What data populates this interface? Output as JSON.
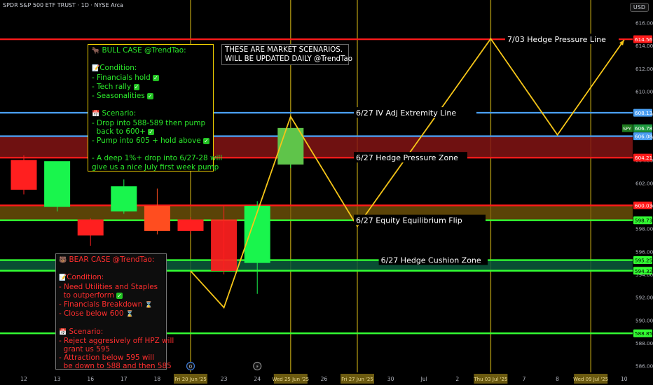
{
  "header": {
    "title": "SPDR S&P 500 ETF TRUST · 1D · NYSE Arca",
    "currency": "USD"
  },
  "chart_data": {
    "type": "candlestick",
    "ylim": [
      585,
      617
    ],
    "y_ticks": [
      586,
      588,
      590,
      592,
      594,
      596,
      598,
      600,
      602,
      604,
      606,
      608,
      610,
      612,
      614,
      616
    ],
    "x_ticks": [
      {
        "label": "12",
        "highlight": false
      },
      {
        "label": "13",
        "highlight": false
      },
      {
        "label": "16",
        "highlight": false
      },
      {
        "label": "17",
        "highlight": false
      },
      {
        "label": "18",
        "highlight": false
      },
      {
        "label": "Fri 20 Jun '25",
        "highlight": true
      },
      {
        "label": "23",
        "highlight": false
      },
      {
        "label": "24",
        "highlight": false
      },
      {
        "label": "Wed 25 Jun '25",
        "highlight": true
      },
      {
        "label": "26",
        "highlight": false
      },
      {
        "label": "Fri 27 Jun '25",
        "highlight": true
      },
      {
        "label": "30",
        "highlight": false
      },
      {
        "label": "Jul",
        "highlight": false
      },
      {
        "label": "2",
        "highlight": false
      },
      {
        "label": "Thu 03 Jul '25",
        "highlight": true
      },
      {
        "label": "7",
        "highlight": false
      },
      {
        "label": "8",
        "highlight": false
      },
      {
        "label": "Wed 09 Jul '25",
        "highlight": true
      },
      {
        "label": "10",
        "highlight": false
      }
    ],
    "candles": [
      {
        "slot": 0,
        "open": 604.0,
        "high": 604.4,
        "close": 601.4,
        "low": 601.0,
        "color": "red"
      },
      {
        "slot": 1,
        "open": 599.9,
        "high": 601.0,
        "close": 603.9,
        "low": 599.5,
        "color": "green"
      },
      {
        "slot": 2,
        "open": 598.8,
        "high": 598.9,
        "close": 597.4,
        "low": 596.5,
        "color": "red"
      },
      {
        "slot": 3,
        "open": 599.5,
        "high": 602.3,
        "close": 601.7,
        "low": 599.3,
        "color": "green"
      },
      {
        "slot": 4,
        "open": 600.0,
        "high": 601.5,
        "close": 597.8,
        "low": 597.5,
        "color": "orange"
      },
      {
        "slot": 5,
        "open": 598.8,
        "high": 599.0,
        "close": 597.8,
        "low": 597.5,
        "color": "red"
      },
      {
        "slot": 6,
        "open": 598.8,
        "high": 600.0,
        "close": 594.3,
        "low": 594.0,
        "color": "red"
      },
      {
        "slot": 7,
        "open": 595.0,
        "high": 600.4,
        "close": 600.0,
        "low": 592.3,
        "color": "green"
      },
      {
        "slot": 8,
        "open": 603.6,
        "high": 606.0,
        "close": 606.8,
        "low": 603.3,
        "color": "green"
      }
    ],
    "scenario_path": [
      {
        "slot": 5,
        "value": 594.3
      },
      {
        "slot": 6,
        "value": 591.1
      },
      {
        "slot": 8,
        "value": 607.8
      },
      {
        "slot": 10,
        "value": 598.2
      },
      {
        "slot": 14,
        "value": 614.6
      },
      {
        "slot": 16,
        "value": 606.2
      },
      {
        "slot": 18,
        "value": 614.5
      }
    ],
    "levels": [
      {
        "label": "7/03 Hedge Pressure Line",
        "value": 614.56,
        "price_label": "614.56",
        "color": "#ff1a1a",
        "label_slot": 15.0
      },
      {
        "label": "6/27 IV Adj Extremity Line",
        "value": 608.13,
        "price_label": "608.13",
        "color": "#4a9ef0",
        "label_slot": 10.0
      },
      {
        "label": "",
        "value": 606.08,
        "price_label": "606.08",
        "color": "#4a9ef0",
        "label_slot": null
      },
      {
        "label": "6/27 Hedge Pressure Zone",
        "value": 604.21,
        "price_label": "604.21",
        "color": "#ff1a1a",
        "label_slot": 10.0
      },
      {
        "label": "",
        "value": 600.03,
        "price_label": "600.03",
        "color": "#ff1a1a",
        "label_slot": null
      },
      {
        "label": "6/27 Equity Equilibrium Flip",
        "value": 598.73,
        "price_label": "598.73",
        "color": "#33ff33",
        "label_slot": 10.0
      },
      {
        "label": "6/27 Hedge Cushion Zone",
        "value": 595.25,
        "price_label": "595.25",
        "color": "#33ff33",
        "label_slot": 11.0
      },
      {
        "label": "",
        "value": 594.32,
        "price_label": "594.32",
        "color": "#33ff33",
        "label_slot": null
      },
      {
        "label": "",
        "value": 588.85,
        "price_label": "588.85",
        "color": "#33ff33",
        "label_slot": null
      }
    ],
    "zones": [
      {
        "from": 604.21,
        "to": 606.08,
        "color": "rgba(130,20,20,0.85)"
      },
      {
        "from": 598.73,
        "to": 600.03,
        "color": "rgba(120,90,10,0.75)"
      },
      {
        "from": 594.32,
        "to": 595.25,
        "color": "rgba(10,90,60,0.85)"
      }
    ],
    "current_price": {
      "symbol": "SPY",
      "value": 606.78,
      "label": "606.78"
    },
    "vertical_markers": [
      5,
      8,
      10,
      14,
      17
    ],
    "bottom_markers": [
      {
        "slot": 5,
        "glyph": "0"
      },
      {
        "slot": 7,
        "glyph": "⚡"
      }
    ]
  },
  "annotations": {
    "bull": {
      "title": "BULL CASE @TrendTao:",
      "condition_heading": "Condition:",
      "conditions": [
        "- Financials hold",
        "- Tech rally",
        "- Seasonalities"
      ],
      "scenario_heading": "Scenario:",
      "scenario_lines": [
        "- Drop into 588-589 then pump",
        "  back to 600+",
        "- Pump into 605 + hold above"
      ],
      "note_lines": [
        "- A deep 1%+ drop into 6/27-28 will",
        "give us a nice July first week pump"
      ]
    },
    "bear": {
      "title": "BEAR CASE @TrendTao:",
      "condition_heading": "Condition:",
      "conditions": [
        "- Need Utilities and Staples",
        "  to outperform",
        "- Financials Breakdown",
        "- Close below 600"
      ],
      "scenario_heading": "Scenario:",
      "scenario_lines": [
        "- Reject aggresively off HPZ will",
        "  grant us 595",
        "- Attraction below 595 will",
        "  be down to 588 and then 585"
      ]
    },
    "note": {
      "line1": "THESE ARE MARKET SCENARIOS.",
      "line2": "WILL BE UPDATED DAILY @TrendTao"
    }
  }
}
